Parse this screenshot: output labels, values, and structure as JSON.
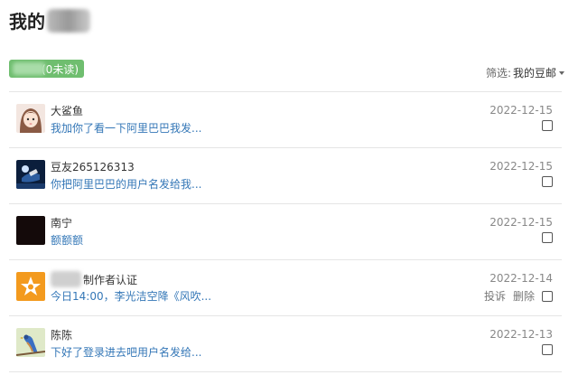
{
  "page": {
    "title_prefix": "我的"
  },
  "unread": {
    "label": "(0未读)"
  },
  "filter": {
    "label": "筛选:",
    "selected": "我的豆邮"
  },
  "messages": [
    {
      "sender": "大鲨鱼",
      "preview": "我加你了看一下阿里巴巴我发...",
      "date": "2022-12-15",
      "avatar_icon": "cartoon-girl-avatar-icon"
    },
    {
      "sender": "豆友265126313",
      "preview": "你把阿里巴巴的用户名发给我...",
      "date": "2022-12-15",
      "avatar_icon": "blue-night-avatar-icon"
    },
    {
      "sender": "南宁",
      "preview": "额额额",
      "date": "2022-12-15",
      "avatar_icon": "dark-avatar-icon"
    },
    {
      "sender": "制作者认证",
      "preview": "今日14:00，李光洁空降《风吹...",
      "date": "2022-12-14",
      "avatar_icon": "orange-star-avatar-icon",
      "report_label": "投诉",
      "delete_label": "删除"
    },
    {
      "sender": "陈陈",
      "preview": "下好了登录进去吧用户名发给...",
      "date": "2022-12-13",
      "avatar_icon": "bird-avatar-icon"
    }
  ],
  "colors": {
    "badge_green": "#6fbe6f",
    "link_blue": "#3477b7",
    "divider": "#e5e5e5"
  }
}
